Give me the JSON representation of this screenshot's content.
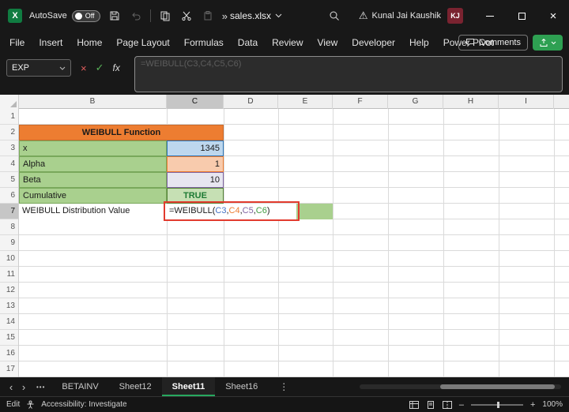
{
  "title_bar": {
    "autosave_label": "AutoSave",
    "autosave_state": "Off",
    "filename": "sales.xlsx",
    "user_name": "Kunal Jai Kaushik",
    "user_initials": "KJ"
  },
  "ribbon": {
    "tabs": [
      "File",
      "Insert",
      "Home",
      "Page Layout",
      "Formulas",
      "Data",
      "Review",
      "View",
      "Developer",
      "Help",
      "Power Pivot"
    ],
    "comments_label": "Comments"
  },
  "formula_bar": {
    "name_box_value": "EXP",
    "formula_text": "=WEIBULL(C3,C4,C5,C6)"
  },
  "grid": {
    "column_headers": [
      "B",
      "C",
      "D",
      "E",
      "F",
      "G",
      "H",
      "I"
    ],
    "row_numbers": [
      "1",
      "2",
      "3",
      "4",
      "5",
      "6",
      "7",
      "8",
      "9",
      "10",
      "11",
      "12",
      "13",
      "14",
      "15",
      "16",
      "17"
    ],
    "title": "WEIBULL Function",
    "rows": [
      {
        "label": "x",
        "value": "1345"
      },
      {
        "label": "Alpha",
        "value": "1"
      },
      {
        "label": "Beta",
        "value": "10"
      },
      {
        "label": "Cumulative",
        "value": "TRUE"
      },
      {
        "label": "WEIBULL Distribution Value",
        "value": "=WEIBULL(C3,C4,C5,C6)"
      }
    ],
    "formula_parts": [
      {
        "text": "=WEIBULL(",
        "color": "#1a1a1a"
      },
      {
        "text": "C3",
        "color": "#4472c4"
      },
      {
        "text": ",",
        "color": "#1a1a1a"
      },
      {
        "text": "C4",
        "color": "#ed7d31"
      },
      {
        "text": ",",
        "color": "#1a1a1a"
      },
      {
        "text": "C5",
        "color": "#8064a2"
      },
      {
        "text": ",",
        "color": "#1a1a1a"
      },
      {
        "text": "C6",
        "color": "#3f9b41"
      },
      {
        "text": ")",
        "color": "#1a1a1a"
      }
    ],
    "colors": {
      "title_fill": "#ED7D31",
      "label_fill": "#A9D08E",
      "c3_fill": "#BDD7EE",
      "c3_border": "#2E75B6",
      "c4_fill": "#F8CBAD",
      "c4_border": "#ED7D31",
      "c5_fill": "#E7E6F0",
      "c5_border": "#8064A2",
      "c6_fill": "#C6E0B4",
      "c6_border": "#548235",
      "true_text": "#1d7a34",
      "result_fill": "#A9D08E",
      "annotation_border": "#E23B2E"
    }
  },
  "sheet_tabs": {
    "tabs": [
      "BETAINV",
      "Sheet12",
      "Sheet11",
      "Sheet16"
    ],
    "active_tab": "Sheet11"
  },
  "status_bar": {
    "mode": "Edit",
    "accessibility_text": "Accessibility: Investigate",
    "zoom_level": "100%"
  },
  "icons": {
    "cancel": "×",
    "close": "×",
    "enter": "✓",
    "fx": "fx",
    "more_commands": "»",
    "nav_left": "‹",
    "nav_right": "›",
    "menu_dots": "⋮",
    "warning": "⚠",
    "tab_ellipsis": "•••",
    "chevron_down": "⌄",
    "zoom_out": "–",
    "zoom_in": "+"
  }
}
